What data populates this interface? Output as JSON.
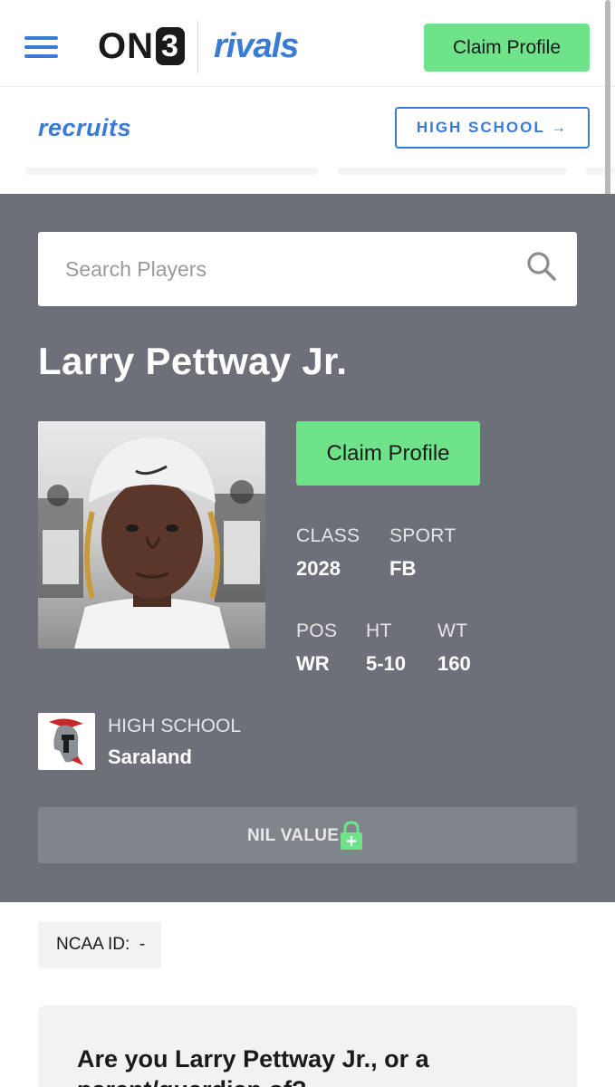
{
  "header": {
    "logo_on3_text": "ON",
    "logo_on3_digit": "3",
    "logo_rivals": "rivals",
    "claim_button": "Claim Profile"
  },
  "subnav": {
    "section_logo": "recruits",
    "level_button": "HIGH SCHOOL →"
  },
  "search": {
    "placeholder": "Search Players"
  },
  "player": {
    "name": "Larry Pettway Jr.",
    "claim_button": "Claim Profile",
    "stats": {
      "class_label": "CLASS",
      "class_value": "2028",
      "sport_label": "SPORT",
      "sport_value": "FB",
      "pos_label": "POS",
      "pos_value": "WR",
      "ht_label": "HT",
      "ht_value": "5-10",
      "wt_label": "WT",
      "wt_value": "160"
    },
    "school_label": "HIGH SCHOOL",
    "school_name": "Saraland",
    "nil_label": "NIL VALUE"
  },
  "ncaa": {
    "label": "NCAA ID:",
    "value": "-"
  },
  "claim_card": {
    "title": "Are you Larry Pettway Jr., or a parent/guardian of?"
  },
  "colors": {
    "accent_blue": "#3a7bd5",
    "claim_green": "#6ee38a",
    "hero_gray": "#6d7078",
    "nil_bar": "#80848b"
  },
  "icons": {
    "menu": "hamburger-menu-icon",
    "search": "magnifier-search-icon",
    "arrow": "arrow-right-icon",
    "nil_lock": "lock-plus-icon"
  }
}
